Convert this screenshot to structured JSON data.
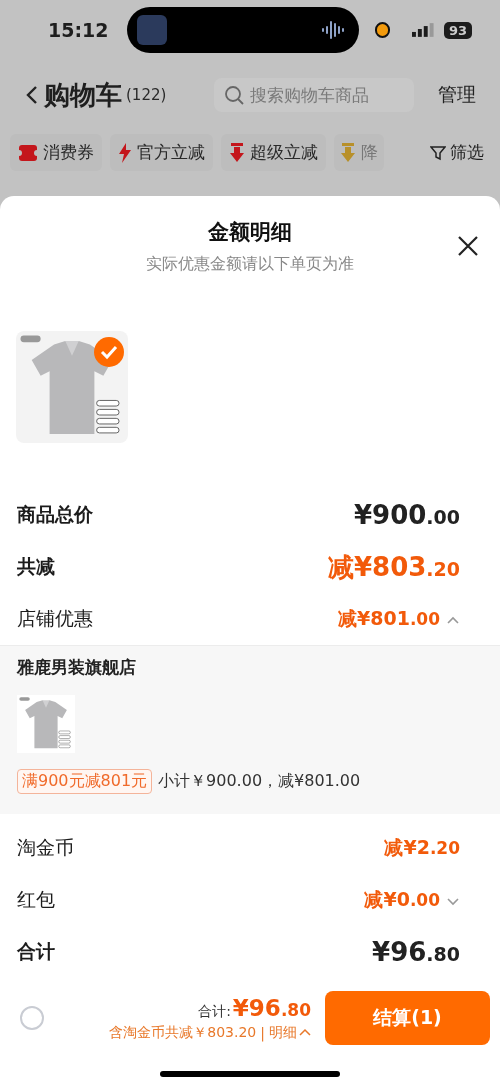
{
  "status_bar": {
    "time": "15:12",
    "battery": "93"
  },
  "header": {
    "title": "购物车",
    "count": "(122)",
    "search": {
      "placeholder": "搜索购物车商品"
    },
    "manage": "管理"
  },
  "filters": [
    {
      "label": "消费券",
      "kind": "coupon"
    },
    {
      "label": "官方立减",
      "kind": "flash"
    },
    {
      "label": "超级立减",
      "kind": "down"
    },
    {
      "label": "降",
      "kind": "drop"
    }
  ],
  "filter_button": "筛选",
  "sheet": {
    "title": "金额明细",
    "subtitle": "实际优惠金额请以下单页为准",
    "product": {
      "checked": true
    },
    "rows": [
      {
        "kind": "big",
        "label": "商品总价",
        "amount": "¥900",
        "decimal": ".00",
        "discount": false
      },
      {
        "kind": "big",
        "label": "共减",
        "amount": "减¥803",
        "decimal": ".20",
        "discount": true
      },
      {
        "kind": "small",
        "label": "店铺优惠",
        "amount": "减¥801",
        "decimal": ".00",
        "discount": true,
        "expanded": true
      },
      {
        "kind": "store",
        "name": "雅鹿男装旗舰店",
        "tag": "满900元减801元",
        "summary": "小计￥900.00，减¥801.00"
      },
      {
        "kind": "small",
        "label": "淘金币",
        "amount": "减¥2",
        "decimal": ".20",
        "discount": true
      },
      {
        "kind": "small",
        "label": "红包",
        "amount": "减¥0",
        "decimal": ".00",
        "discount": true,
        "expanded": false
      },
      {
        "kind": "big",
        "label": "合计",
        "amount": "¥96",
        "decimal": ".80",
        "discount": false
      }
    ]
  },
  "bottom_bar": {
    "select_all": {
      "checked": false
    },
    "total_label": "合计:",
    "total_amount": "¥96",
    "total_decimal": ".80",
    "savings": "含淘金币共减￥803.20",
    "separator": "|",
    "detail_link": "明细",
    "checkout": "结算(1)"
  }
}
